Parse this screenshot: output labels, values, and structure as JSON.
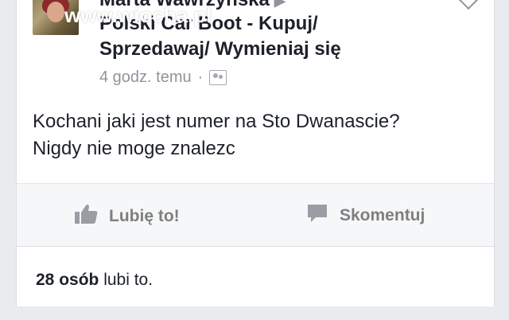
{
  "post": {
    "author": "Marta Wawrzyńska",
    "group_line1": "Polski Car Boot - Kupuj/",
    "group_line2": "Sprzedawaj/ Wymieniaj się",
    "timestamp": "4 godz. temu",
    "separator": "·",
    "audience_icon": "group-icon",
    "text_line1": "Kochani jaki jest numer na Sto Dwanascie?",
    "text_line2": "Nigdy nie moge znalezc"
  },
  "watermark": "www.wiocha.pl",
  "actions": {
    "like_label": "Lubię to!",
    "comment_label": "Skomentuj"
  },
  "likes": {
    "count_text": "28 osób",
    "suffix": "lubi to."
  }
}
